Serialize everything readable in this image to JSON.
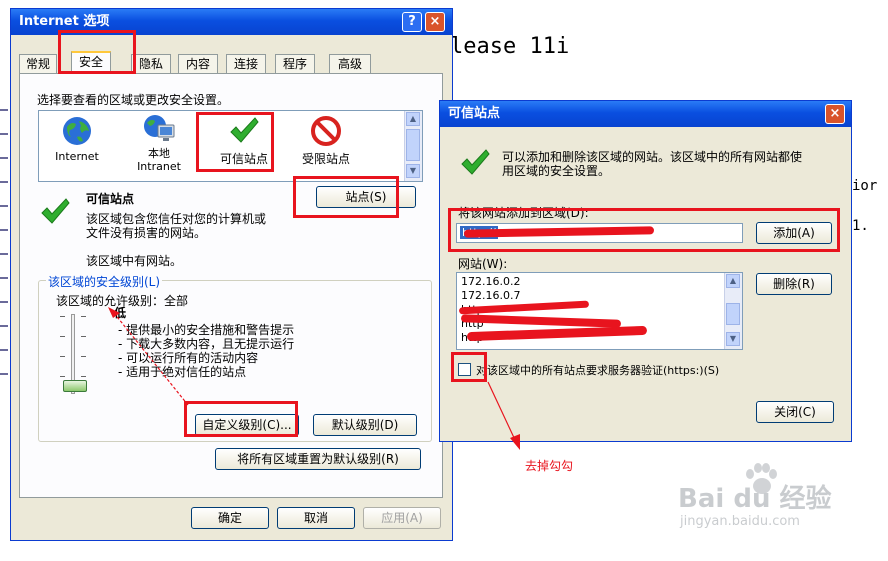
{
  "background": {
    "heading": "lease 11i",
    "right_frag1": "ior",
    "right_frag2": "1."
  },
  "internet_options": {
    "title": "Internet 选项",
    "help_btn": "?",
    "close_btn": "×",
    "tabs": [
      "常规",
      "安全",
      "隐私",
      "内容",
      "连接",
      "程序",
      "高级"
    ],
    "instruction": "选择要查看的区域或更改安全设置。",
    "zones": [
      {
        "label": "Internet",
        "icon": "globe-icon"
      },
      {
        "label": "本地\nIntranet",
        "icon": "local-intranet-icon"
      },
      {
        "label": "可信站点",
        "icon": "trusted-sites-icon"
      },
      {
        "label": "受限站点",
        "icon": "restricted-sites-icon"
      }
    ],
    "zone_title": "可信站点",
    "zone_desc": "该区域包含您信任对您的计算机或文件没有损害的网站。",
    "zone_desc_line1": "该区域包含您信任对您的计算机或",
    "zone_desc_line2": "文件没有损害的网站。",
    "zone_has_sites": "该区域中有网站。",
    "sites_button": "站点(S)",
    "security_level_group": "该区域的安全级别(L)",
    "allowed_levels": "该区域的允许级别：全部",
    "level_name": "低",
    "level_items": [
      "- 提供最小的安全措施和警告提示",
      "- 下载大多数内容，且无提示运行",
      "- 可以运行所有的活动内容",
      "- 适用于绝对信任的站点"
    ],
    "custom_level_button": "自定义级别(C)...",
    "default_level_button": "默认级别(D)",
    "reset_all_button": "将所有区域重置为默认级别(R)",
    "ok_button": "确定",
    "cancel_button": "取消",
    "apply_button": "应用(A)"
  },
  "trusted_sites": {
    "title": "可信站点",
    "close_btn": "×",
    "desc_line1": "可以添加和删除该区域的网站。该区域中的所有网站都使",
    "desc_line2": "用区域的安全设置。",
    "add_label": "将该网站添加到区域(D):",
    "add_input_value": "http://",
    "add_button": "添加(A)",
    "websites_label": "网站(W):",
    "websites": [
      "172.16.0.2",
      "172.16.0.7",
      "http",
      "http",
      "http"
    ],
    "remove_button": "删除(R)",
    "require_https_label": "对该区域中的所有站点要求服务器验证(https:)(S)",
    "require_https_checked": false,
    "close_button": "关闭(C)"
  },
  "annotation": {
    "text": "去掉勾勾"
  },
  "watermark": {
    "brand": "Bai du 经验",
    "url": "jingyan.baidu.com"
  },
  "colors": {
    "accent_red": "#e8141e",
    "titlebar_blue": "#0a4fe0",
    "window_bg": "#ece9d8"
  }
}
